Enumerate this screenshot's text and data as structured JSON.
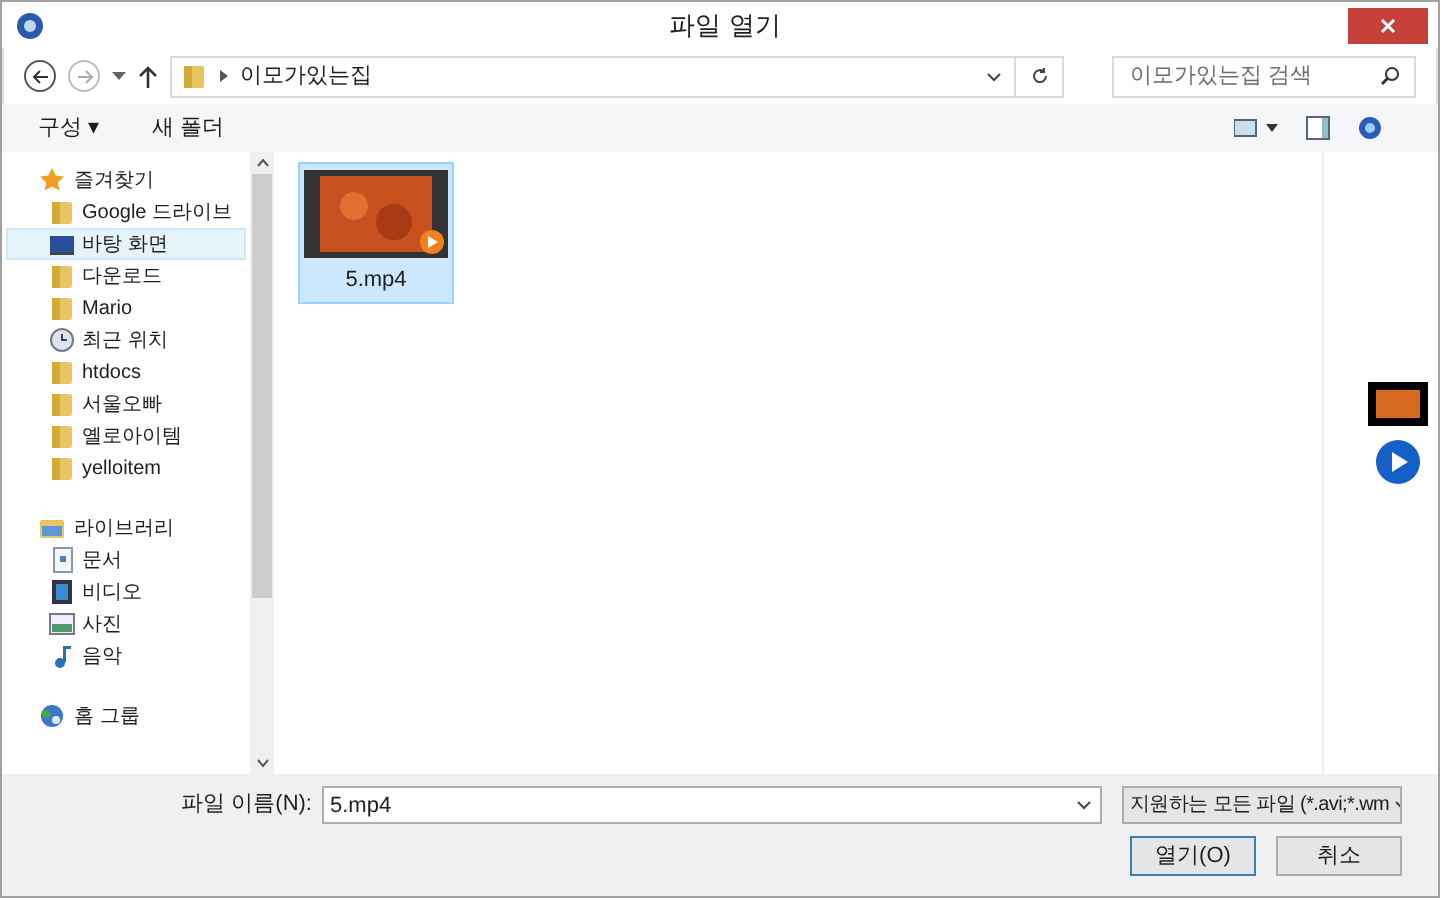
{
  "window": {
    "title": "파일 열기"
  },
  "address_bar": {
    "path": "이모가있는집",
    "search_placeholder": "이모가있는집 검색"
  },
  "toolbar": {
    "organize": "구성 ▾",
    "new_folder": "새 폴더"
  },
  "sidebar": {
    "groups": [
      {
        "label": "즐겨찾기",
        "children": [
          {
            "label": "Google 드라이브",
            "selected": false
          },
          {
            "label": "바탕 화면",
            "selected": true
          },
          {
            "label": "다운로드",
            "selected": false
          },
          {
            "label": "Mario",
            "selected": false
          },
          {
            "label": "최근 위치",
            "selected": false
          },
          {
            "label": "htdocs",
            "selected": false
          },
          {
            "label": "서울오빠",
            "selected": false
          },
          {
            "label": "옐로아이템",
            "selected": false
          },
          {
            "label": "yelloitem",
            "selected": false
          }
        ]
      },
      {
        "label": "라이브러리",
        "children": [
          {
            "label": "문서",
            "selected": false
          },
          {
            "label": "비디오",
            "selected": false
          },
          {
            "label": "사진",
            "selected": false
          },
          {
            "label": "음악",
            "selected": false
          }
        ]
      },
      {
        "label": "홈 그룹"
      }
    ]
  },
  "files": [
    {
      "name": "5.mp4",
      "selected": true
    }
  ],
  "bottom": {
    "filename_label": "파일 이름(N):",
    "filename_value": "5.mp4",
    "filetype": "지원하는 모든 파일 (*.avi;*.wm",
    "open": "열기(O)",
    "cancel": "취소"
  }
}
